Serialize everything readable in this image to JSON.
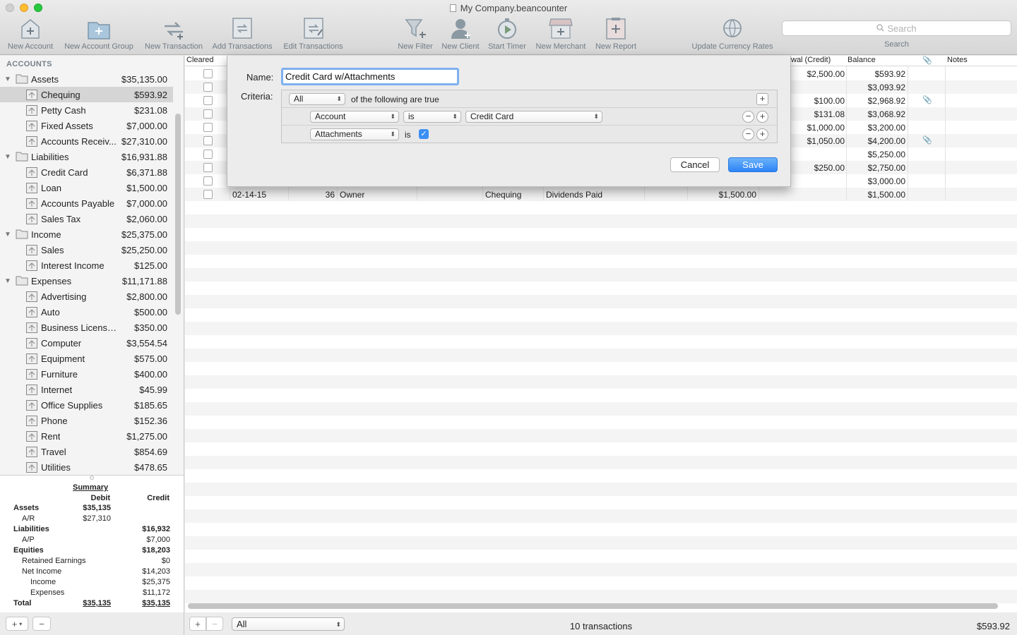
{
  "window": {
    "title": "My Company.beancounter"
  },
  "toolbar": {
    "items": [
      {
        "label": "New Account",
        "icon": "new-account-icon"
      },
      {
        "label": "New Account Group",
        "icon": "new-account-group-icon"
      },
      {
        "label": "New Transaction",
        "icon": "new-transaction-icon"
      },
      {
        "label": "Add Transactions",
        "icon": "add-transactions-icon"
      },
      {
        "label": "Edit Transactions",
        "icon": "edit-transactions-icon"
      },
      {
        "label": "New Filter",
        "icon": "filter-icon"
      },
      {
        "label": "New Client",
        "icon": "client-icon"
      },
      {
        "label": "Start Timer",
        "icon": "timer-icon"
      },
      {
        "label": "New Merchant",
        "icon": "merchant-icon"
      },
      {
        "label": "New Report",
        "icon": "report-icon"
      },
      {
        "label": "Update Currency Rates",
        "icon": "currency-rates-icon"
      }
    ],
    "search_placeholder": "Search",
    "search_label": "Search"
  },
  "sidebar": {
    "heading": "ACCOUNTS",
    "accounts": [
      {
        "name": "Assets",
        "balance": "$35,135.00",
        "group": true
      },
      {
        "name": "Chequing",
        "balance": "$593.92",
        "selected": true
      },
      {
        "name": "Petty Cash",
        "balance": "$231.08"
      },
      {
        "name": "Fixed Assets",
        "balance": "$7,000.00"
      },
      {
        "name": "Accounts Receiv...",
        "balance": "$27,310.00"
      },
      {
        "name": "Liabilities",
        "balance": "$16,931.88",
        "group": true
      },
      {
        "name": "Credit Card",
        "balance": "$6,371.88"
      },
      {
        "name": "Loan",
        "balance": "$1,500.00"
      },
      {
        "name": "Accounts Payable",
        "balance": "$7,000.00"
      },
      {
        "name": "Sales Tax",
        "balance": "$2,060.00"
      },
      {
        "name": "Income",
        "balance": "$25,375.00",
        "group": true
      },
      {
        "name": "Sales",
        "balance": "$25,250.00"
      },
      {
        "name": "Interest Income",
        "balance": "$125.00"
      },
      {
        "name": "Expenses",
        "balance": "$11,171.88",
        "group": true
      },
      {
        "name": "Advertising",
        "balance": "$2,800.00"
      },
      {
        "name": "Auto",
        "balance": "$500.00"
      },
      {
        "name": "Business Licenses/...",
        "balance": "$350.00"
      },
      {
        "name": "Computer",
        "balance": "$3,554.54"
      },
      {
        "name": "Equipment",
        "balance": "$575.00"
      },
      {
        "name": "Furniture",
        "balance": "$400.00"
      },
      {
        "name": "Internet",
        "balance": "$45.99"
      },
      {
        "name": "Office Supplies",
        "balance": "$185.65"
      },
      {
        "name": "Phone",
        "balance": "$152.36"
      },
      {
        "name": "Rent",
        "balance": "$1,275.00"
      },
      {
        "name": "Travel",
        "balance": "$854.69"
      },
      {
        "name": "Utilities",
        "balance": "$478.65"
      }
    ]
  },
  "summary": {
    "title": "Summary",
    "debit_header": "Debit",
    "credit_header": "Credit",
    "lines": [
      {
        "label": "Assets",
        "debit": "$35,135",
        "credit": "",
        "bold": true
      },
      {
        "label": "A/R",
        "debit": "$27,310",
        "credit": "",
        "indent": 1
      },
      {
        "label": "Liabilities",
        "debit": "",
        "credit": "$16,932",
        "bold": true
      },
      {
        "label": "A/P",
        "debit": "",
        "credit": "$7,000",
        "indent": 1
      },
      {
        "label": "Equities",
        "debit": "",
        "credit": "$18,203",
        "bold": true
      },
      {
        "label": "Retained Earnings",
        "debit": "",
        "credit": "$0",
        "indent": 1
      },
      {
        "label": "Net Income",
        "debit": "",
        "credit": "$14,203",
        "indent": 1
      },
      {
        "label": "Income",
        "debit": "",
        "credit": "$25,375",
        "indent": 2
      },
      {
        "label": "Expenses",
        "debit": "",
        "credit": "$11,172",
        "indent": 2
      },
      {
        "label": "Total",
        "debit": "$35,135",
        "credit": "$35,135",
        "bold": true,
        "total": true
      }
    ]
  },
  "transactions": {
    "headers": {
      "cleared": "Cleared",
      "withdrawal": "wal (Credit)",
      "balance": "Balance",
      "notes": "Notes"
    },
    "rows": [
      {
        "withdrawal": "$2,500.00",
        "balance": "$593.92"
      },
      {
        "balance": "$3,093.92"
      },
      {
        "withdrawal": "$100.00",
        "balance": "$2,968.92",
        "attachment": true
      },
      {
        "withdrawal": "$131.08",
        "balance": "$3,068.92"
      },
      {
        "withdrawal": "$1,000.00",
        "balance": "$3,200.00"
      },
      {
        "withdrawal": "$1,050.00",
        "balance": "$4,200.00",
        "attachment": true
      },
      {
        "balance": "$5,250.00"
      },
      {
        "withdrawal": "$250.00",
        "balance": "$2,750.00"
      },
      {
        "balance": "$3,000.00"
      },
      {
        "date": "02-14-15",
        "number": "36",
        "payee": "Owner",
        "account": "Chequing",
        "category": "Dividends Paid",
        "deposit": "$1,500.00",
        "balance": "$1,500.00"
      }
    ],
    "count_text": "10 transactions",
    "filter_value": "All",
    "total_balance": "$593.92"
  },
  "filter_dialog": {
    "name_label": "Name:",
    "name_value": "Credit Card w/Attachments",
    "criteria_label": "Criteria:",
    "match_value": "All",
    "match_suffix": "of the following are true",
    "rules": [
      {
        "field": "Account",
        "operator": "is",
        "value": "Credit Card"
      },
      {
        "field": "Attachments",
        "operator": "is",
        "checked": true
      }
    ],
    "cancel_label": "Cancel",
    "save_label": "Save"
  },
  "colors": {
    "accent": "#3b8ff5",
    "selection": "#d5d5d5"
  }
}
